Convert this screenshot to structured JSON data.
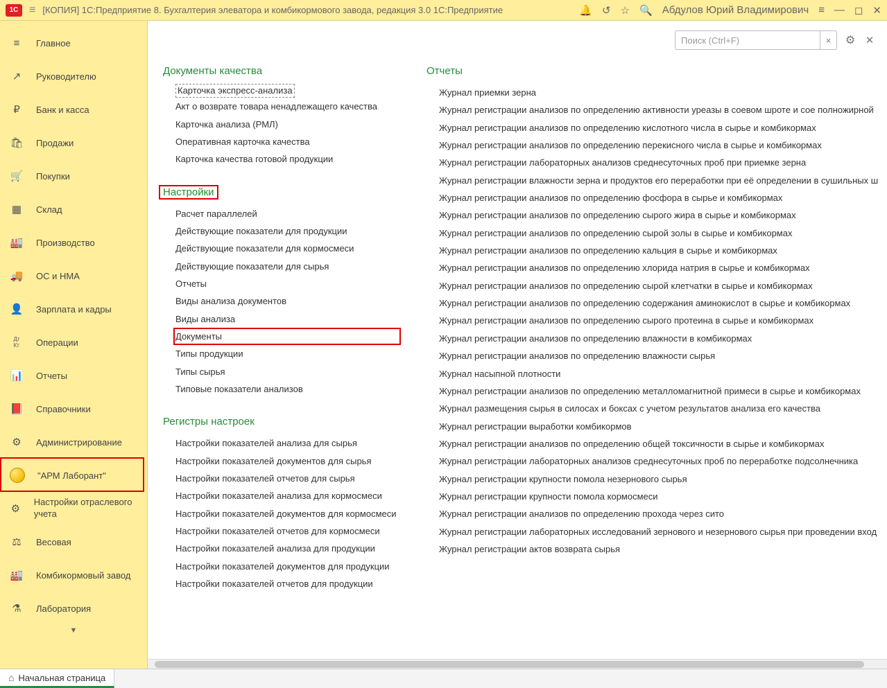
{
  "titlebar": {
    "title": "[КОПИЯ] 1С:Предприятие 8. Бухгалтерия элеватора и комбикормового завода, редакция 3.0 1С:Предприятие",
    "user": "Абдулов Юрий Владимирович",
    "logo": "1С"
  },
  "search": {
    "placeholder": "Поиск (Ctrl+F)",
    "value": ""
  },
  "sidebar": {
    "items": [
      {
        "icon": "≡",
        "label": "Главное"
      },
      {
        "icon": "↗",
        "label": "Руководителю"
      },
      {
        "icon": "₽",
        "label": "Банк и касса"
      },
      {
        "icon": "🛍",
        "label": "Продажи"
      },
      {
        "icon": "🛒",
        "label": "Покупки"
      },
      {
        "icon": "▦",
        "label": "Склад"
      },
      {
        "icon": "🏭",
        "label": "Производство"
      },
      {
        "icon": "🚚",
        "label": "ОС и НМА"
      },
      {
        "icon": "👤",
        "label": "Зарплата и кадры"
      },
      {
        "icon": "Дт Кт",
        "label": "Операции"
      },
      {
        "icon": "📊",
        "label": "Отчеты"
      },
      {
        "icon": "📕",
        "label": "Справочники"
      },
      {
        "icon": "⚙",
        "label": "Администрирование"
      },
      {
        "icon": "●",
        "label": "\"АРМ Лаборант\""
      },
      {
        "icon": "⚙",
        "label": "Настройки отраслевого учета"
      },
      {
        "icon": "⚖",
        "label": "Весовая"
      },
      {
        "icon": "🏭",
        "label": "Комбикормовый завод"
      },
      {
        "icon": "⚗",
        "label": "Лаборатория"
      }
    ],
    "active_index": 13
  },
  "sections": {
    "left": [
      {
        "title": "Документы качества",
        "items": [
          "Карточка экспресс-анализа",
          "Акт о возврате товара ненадлежащего качества",
          "Карточка анализа (РМЛ)",
          "Оперативная карточка качества",
          "Карточка качества готовой продукции"
        ]
      },
      {
        "title": "Настройки",
        "items": [
          "Расчет параллелей",
          "Действующие показатели для продукции",
          "Действующие показатели для кормосмеси",
          "Действующие показатели для сырья",
          "Отчеты",
          "Виды анализа документов",
          "Виды анализа",
          "Документы",
          "Типы продукции",
          "Типы сырья",
          "Типовые показатели анализов"
        ]
      },
      {
        "title": "Регистры настроек",
        "items": [
          "Настройки показателей анализа для сырья",
          "Настройки показателей документов для сырья",
          "Настройки показателей отчетов для сырья",
          "Настройки показателей анализа для кормосмеси",
          "Настройки показателей документов для кормосмеси",
          "Настройки показателей отчетов для кормосмеси",
          "Настройки показателей анализа для продукции",
          "Настройки показателей документов для продукции",
          "Настройки показателей отчетов для продукции"
        ]
      }
    ],
    "right": [
      {
        "title": "Отчеты",
        "items": [
          "Журнал приемки зерна",
          "Журнал регистрации анализов по определению активности уреазы в соевом шроте и сое полножирной",
          "Журнал регистрации анализов по определению кислотного числа в сырье и комбикормах",
          "Журнал регистрации анализов по определению перекисного числа в сырье и комбикормах",
          "Журнал регистрации лабораторных анализов среднесуточных проб при приемке зерна",
          "Журнал регистрации влажности зерна и продуктов его переработки при её определении в сушильных ш",
          "Журнал регистрации анализов по определению фосфора в сырье и комбикормах",
          "Журнал регистрации анализов по определению сырого жира в сырье и комбикормах",
          "Журнал регистрации анализов по определению сырой золы в сырье и комбикормах",
          "Журнал регистрации анализов по определению кальция в сырье и комбикормах",
          "Журнал регистрации анализов по определению хлорида натрия в сырье и комбикормах",
          "Журнал регистрации анализов по определению сырой клетчатки в сырье и комбикормах",
          "Журнал регистрации анализов по определению содержания аминокислот в сырье и комбикормах",
          "Журнал регистрации анализов по определению сырого протеина в сырье и комбикормах",
          "Журнал регистрации анализов по определению влажности в комбикормах",
          "Журнал регистрации анализов по определению влажности сырья",
          "Журнал насыпной плотности",
          "Журнал регистрации анализов по определению металломагнитной примеси в сырье и комбикормах",
          "Журнал размещения сырья в силосах и боксах с учетом результатов анализа его качества",
          "Журнал регистрации выработки комбикормов",
          "Журнал регистрации анализов по определению общей токсичности в сырье и комбикормах",
          "Журнал регистрации лабораторных анализов среднесуточных проб по переработке подсолнечника",
          "Журнал регистрации крупности помола незернового сырья",
          "Журнал регистрации крупности помола кормосмеси",
          "Журнал регистрации анализов по определению прохода через сито",
          "Журнал регистрации лабораторных исследований зернового и незернового сырья при проведении вход",
          "Журнал регистрации актов возврата сырья"
        ]
      }
    ]
  },
  "bottom": {
    "home_tab": "Начальная страница"
  },
  "highlights": {
    "sidebar_active": 13,
    "section_titles": [
      "Настройки"
    ],
    "link_items": [
      "Документы"
    ]
  }
}
